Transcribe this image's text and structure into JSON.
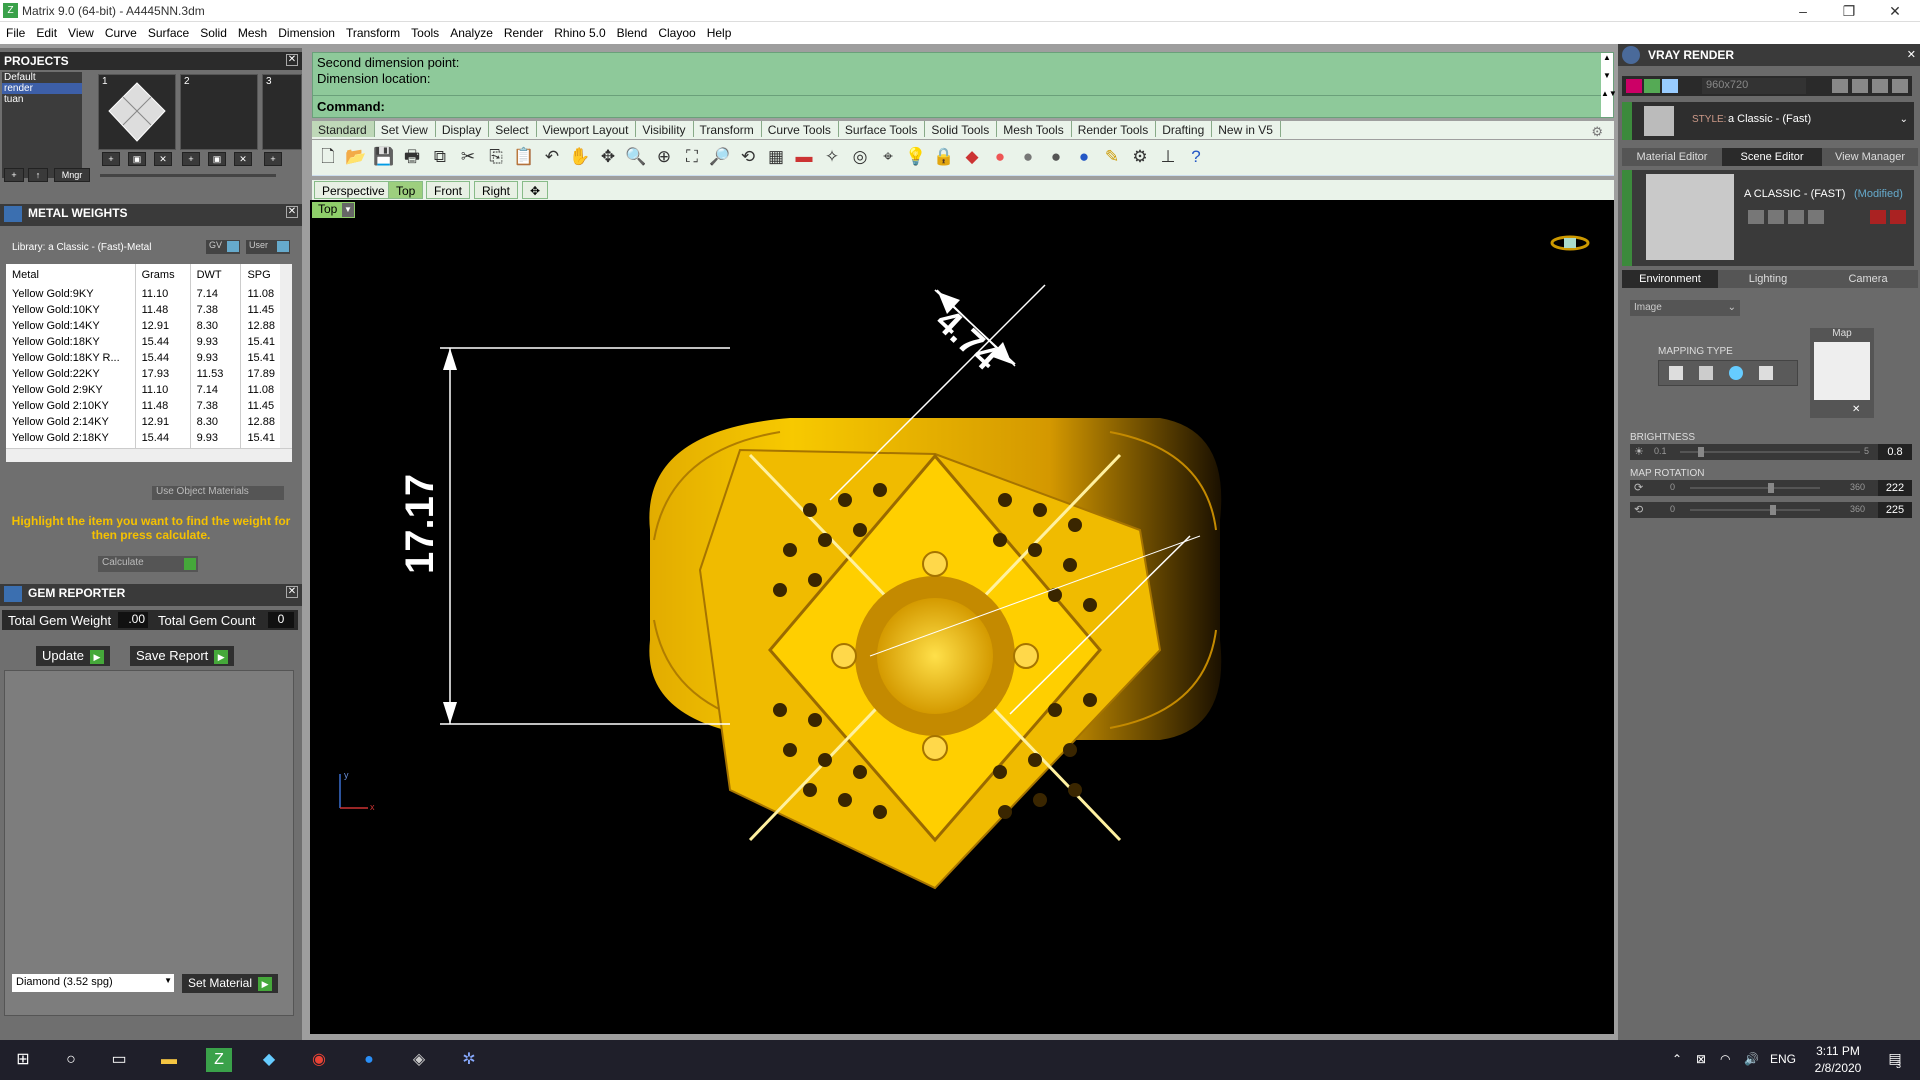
{
  "window": {
    "title": "Matrix 9.0 (64-bit) - A4445NN.3dm",
    "app_icon": "Z"
  },
  "menu": [
    "File",
    "Edit",
    "View",
    "Curve",
    "Surface",
    "Solid",
    "Mesh",
    "Dimension",
    "Transform",
    "Tools",
    "Analyze",
    "Render",
    "Rhino 5.0",
    "Blend",
    "Clayoo",
    "Help"
  ],
  "projects": {
    "title": "PROJECTS",
    "items": [
      "Default",
      "render",
      "tuan"
    ],
    "slots": [
      "1",
      "2",
      "3"
    ],
    "mngr": "Mngr"
  },
  "metal_weights": {
    "title": "METAL WEIGHTS",
    "library": "Library: a Classic - (Fast)-Metal",
    "gv": "GV",
    "user": "User",
    "columns": [
      "Metal",
      "Grams",
      "DWT",
      "SPG"
    ],
    "rows": [
      [
        "Yellow Gold:9KY",
        "11.10",
        "7.14",
        "11.08"
      ],
      [
        "Yellow Gold:10KY",
        "11.48",
        "7.38",
        "11.45"
      ],
      [
        "Yellow Gold:14KY",
        "12.91",
        "8.30",
        "12.88"
      ],
      [
        "Yellow Gold:18KY",
        "15.44",
        "9.93",
        "15.41"
      ],
      [
        "Yellow Gold:18KY R...",
        "15.44",
        "9.93",
        "15.41"
      ],
      [
        "Yellow Gold:22KY",
        "17.93",
        "11.53",
        "17.89"
      ],
      [
        "Yellow Gold 2:9KY",
        "11.10",
        "7.14",
        "11.08"
      ],
      [
        "Yellow Gold 2:10KY",
        "11.48",
        "7.38",
        "11.45"
      ],
      [
        "Yellow Gold 2:14KY",
        "12.91",
        "8.30",
        "12.88"
      ],
      [
        "Yellow Gold 2:18KY",
        "15.44",
        "9.93",
        "15.41"
      ],
      [
        "Yellow Gold 2:18KY...",
        "15.44",
        "9.93",
        "15.41"
      ]
    ],
    "use_object_materials": "Use Object Materials",
    "hint": "Highlight the item you want to find the weight for then press calculate.",
    "calculate": "Calculate"
  },
  "gem_reporter": {
    "title": "GEM REPORTER",
    "total_weight_label": "Total Gem Weight",
    "total_weight": ".00",
    "total_count_label": "Total Gem Count",
    "total_count": "0",
    "update": "Update",
    "save_report": "Save Report",
    "material": "Diamond    (3.52 spg)",
    "set_material": "Set Material"
  },
  "command": {
    "line1": "Second dimension point:",
    "line2": "Dimension location:",
    "label": "Command:"
  },
  "toolbar_tabs": [
    "Standard",
    "Set View",
    "Display",
    "Select",
    "Viewport Layout",
    "Visibility",
    "Transform",
    "Curve Tools",
    "Surface Tools",
    "Solid Tools",
    "Mesh Tools",
    "Render Tools",
    "Drafting",
    "New in V5"
  ],
  "viewport_tabs": [
    "Perspective",
    "Top",
    "Front",
    "Right"
  ],
  "viewport": {
    "name": "Top",
    "dim_vertical": "17.17",
    "dim_diagonal": "4.74",
    "axis_y": "y",
    "axis_x": "x"
  },
  "vray": {
    "title": "VRAY RENDER",
    "resolution": "960x720",
    "style_label": "STYLE:",
    "style": "a Classic - (Fast)",
    "tabs": [
      "Material Editor",
      "Scene Editor",
      "View Manager"
    ],
    "scene_name": "A CLASSIC - (FAST)",
    "modified": "(Modified)",
    "env_tabs": [
      "Environment",
      "Lighting",
      "Camera"
    ],
    "env_type": "Image",
    "mapping_type": "MAPPING TYPE",
    "map_label": "Map",
    "brightness": "BRIGHTNESS",
    "b_min": "0.1",
    "b_max": "5",
    "b_val": "0.8",
    "map_rotation": "MAP ROTATION",
    "r_min": "0",
    "r_max": "360",
    "r1_val": "222",
    "r2_val": "225"
  },
  "taskbar": {
    "lang": "ENG",
    "time": "3:11 PM",
    "date": "2/8/2020",
    "notif": "3"
  },
  "colors": {
    "gold": "#f5c100",
    "command_bg": "#8ec99a",
    "panel_dark": "#2b2b2b"
  }
}
